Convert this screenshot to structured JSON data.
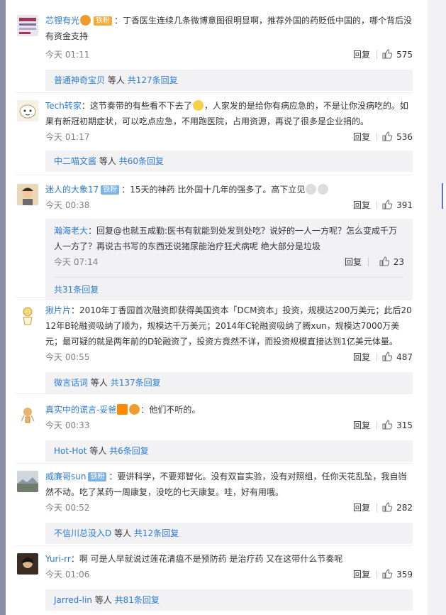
{
  "comments": [
    {
      "user": "芯锂有光",
      "badges": [
        "铁粉"
      ],
      "text": "：丁香医生连续几条微博意图很明显啊，推荐外国的药贬低中国的，哪个背后没有资金支持",
      "time": "今天 01:11",
      "reply_label": "回复",
      "likes": "575",
      "replies_user": "普通神奇宝贝",
      "replies_suffix": "等人",
      "replies_count": "共127条回复"
    },
    {
      "user": "Tech转家",
      "text_a": "：这节奏带的有些看不下去了",
      "text_b": "，人家发的是给你有病应急的，不是让你没病吃的。如果有新冠初期症状，可以吃点应急，不用跑医院，占用资源，再说了很多是企业捐的。",
      "time": "今天 01:17",
      "reply_label": "回复",
      "likes": "536",
      "replies_user": "中二喵文酱",
      "replies_suffix": "等人",
      "replies_count": "共60条回复"
    },
    {
      "user": "迷人的大象17",
      "badge": "铁粉",
      "text": "：15天的神药 比外国十几年的强多了。高下立见",
      "time": "今天 00:38",
      "reply_label": "回复",
      "likes": "391",
      "sub_user": "瀚海老大",
      "sub_text": "：回复@也就五成勤:医书有就能到处发到处吃？说好的一人一方呢？怎么变成千万人一方了？再说古书写的东西还说猪尿能治疗狂犬病呢 绝大部分是垃圾",
      "sub_time": "今天 07:14",
      "sub_likes": "23",
      "replies_count": "共31条回复"
    },
    {
      "user": "揪片片",
      "text": "：2010年丁香园首次融资即获得美国资本「DCM资本」投资，规模达200万美元；此后2012年B轮融资吸纳了顺为，规模达千万美元；2014年C轮融资吸纳了腾xun，规模达7000万美元；最可疑的就是两年前的D轮融资了，投资方竟然不详，而投资规模直接达到1亿美元体量。",
      "time": "今天 00:55",
      "reply_label": "回复",
      "likes": "487",
      "replies_user": "微言话词",
      "replies_suffix": "等人",
      "replies_count": "共137条回复"
    },
    {
      "user": "真实中的谎言-妥爸",
      "text": "：他们不听的。",
      "time": "今天 00:33",
      "reply_label": "回复",
      "likes": "315",
      "replies_user": "Hot-Hot",
      "replies_suffix": "等人",
      "replies_count": "共6条回复"
    },
    {
      "user": "威廉哥sun",
      "badge": "铁粉",
      "text": "：要讲科学，不要郑智化。没有双盲实验，没有对照组，任你天花乱坠，我自岿然不动。吃了某药一周康复，没吃的七天康复。哇，好有用哦。",
      "time": "今天 00:52",
      "reply_label": "回复",
      "likes": "282",
      "replies_user": "不信川总没入D",
      "replies_suffix": "等人",
      "replies_count": "共12条回复"
    },
    {
      "user": "Yuri-rr",
      "text": "：啊 可是人早就说过莲花清瘟不是预防药 是治疗药 又在这带什么节奏呢",
      "time": "今天 01:06",
      "reply_label": "回复",
      "likes": "359",
      "replies_user": "Jarred-lin",
      "replies_suffix": "等人",
      "replies_count": "共81条回复"
    }
  ],
  "colors": {
    "accent": "#2e7bd0",
    "reply_bg": "#f2f2f5",
    "text": "#333333",
    "meta": "#808080"
  }
}
